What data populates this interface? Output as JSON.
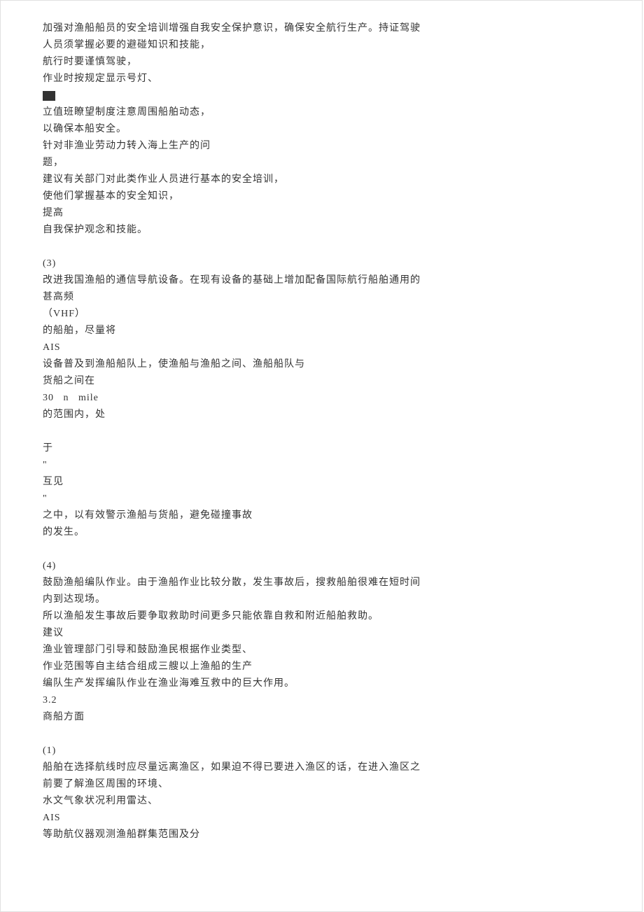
{
  "lines": [
    "加强对渔船船员的安全培训增强自我安全保护意识，确保安全航行生产。持证驾驶",
    "人员须掌握必要的避碰知识和技能，",
    "航行时要谨慎驾驶，",
    "作业时按规定显示号灯、",
    "__SMUDGE__",
    "立值班瞭望制度注意周围船舶动态，",
    "以确保本船安全。",
    "针对非渔业劳动力转入海上生产的问",
    "题，",
    "建议有关部门对此类作业人员进行基本的安全培训，",
    "使他们掌握基本的安全知识，",
    "提高",
    "自我保护观念和技能。",
    "",
    "(3)",
    "改进我国渔船的通信导航设备。在现有设备的基础上增加配备国际航行船舶通用的",
    "甚高频",
    "（VHF）",
    "的船舶，尽量将",
    "AIS",
    "设备普及到渔船船队上，使渔船与渔船之间、渔船船队与",
    "货船之间在",
    "30   n   mile",
    "的范围内，处",
    "",
    "于",
    "\"",
    "互见",
    "\"",
    "之中，以有效警示渔船与货船，避免碰撞事故",
    "的发生。",
    "",
    "(4)",
    "鼓励渔船编队作业。由于渔船作业比较分散，发生事故后，搜救船舶很难在短时间",
    "内到达现场。",
    "所以渔船发生事故后要争取救助时间更多只能依靠自救和附近船舶救助。",
    "建议",
    "渔业管理部门引导和鼓励渔民根据作业类型、",
    "作业范围等自主结合组成三艘以上渔船的生产",
    "编队生产发挥编队作业在渔业海难互救中的巨大作用。",
    "3.2",
    "商船方面",
    "",
    "(1)",
    "船舶在选择航线时应尽量远离渔区，如果迫不得已要进入渔区的话，在进入渔区之",
    "前要了解渔区周围的环境、",
    "水文气象状况利用雷达、",
    "AIS",
    "等助航仪器观测渔船群集范围及分"
  ]
}
